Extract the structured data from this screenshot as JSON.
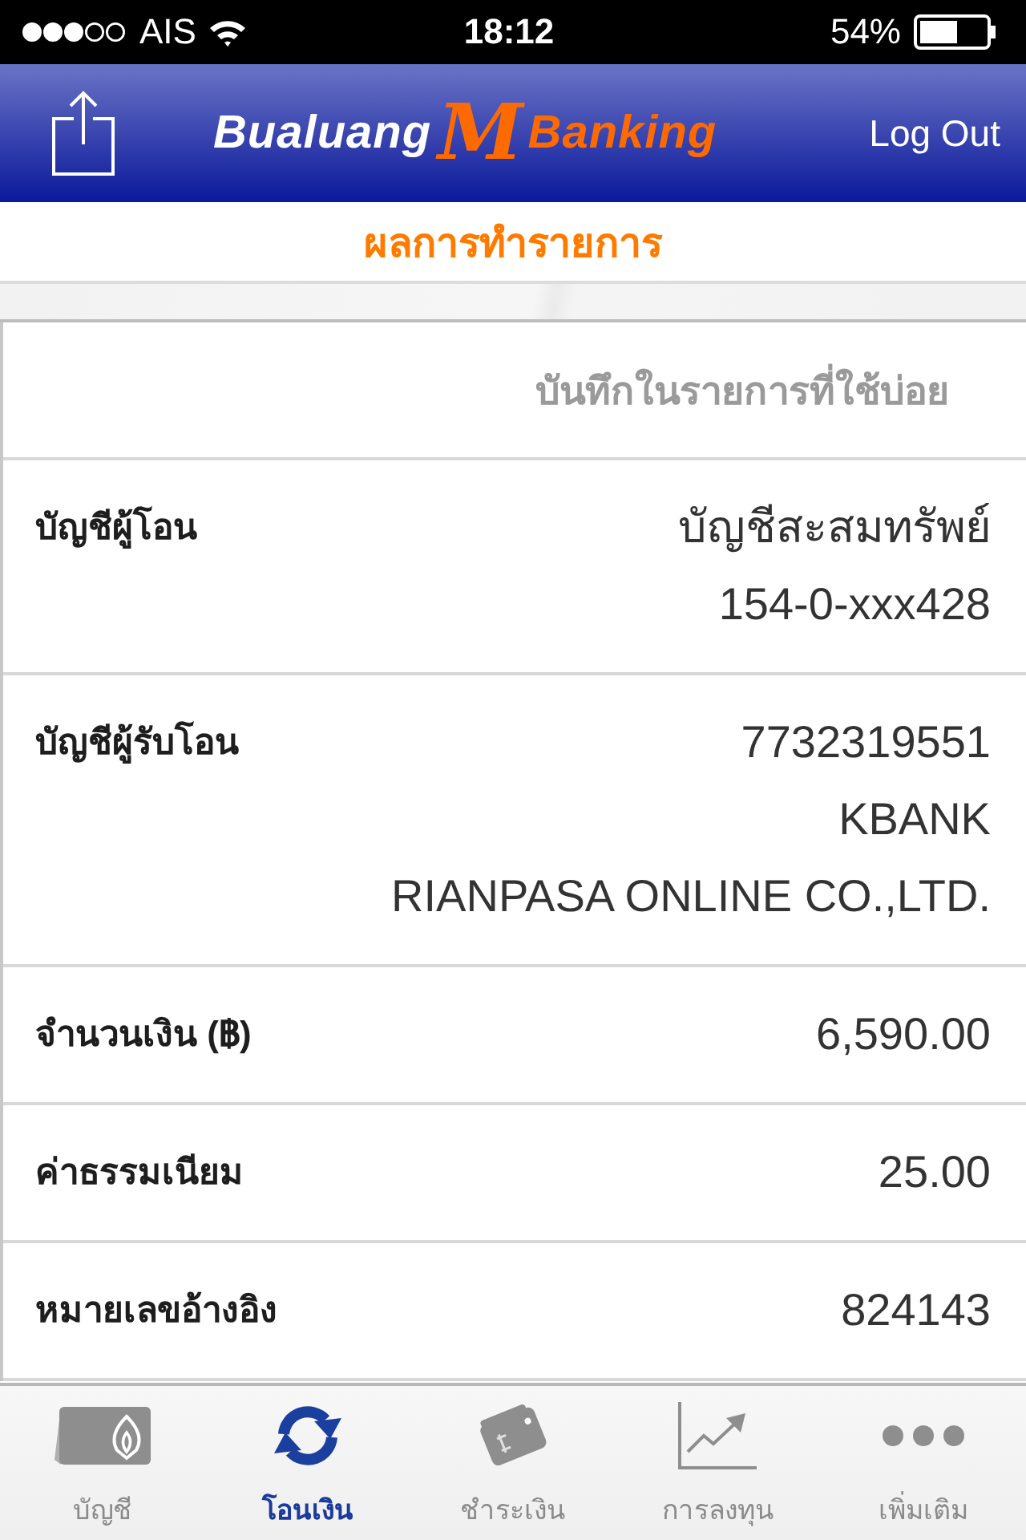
{
  "status_bar": {
    "carrier": "AIS",
    "time": "18:12",
    "battery": "54%"
  },
  "header": {
    "logo": {
      "left": "Bualuang",
      "mark": "M",
      "right": "Banking"
    },
    "logout": "Log Out"
  },
  "page_title": "ผลการทำรายการ",
  "save_favorite": "บันทึกในรายการที่ใช้บ่อย",
  "details": [
    {
      "label": "บัญชีผู้โอน",
      "values": [
        "บัญชีสะสมทรัพย์",
        "154-0-xxx428"
      ]
    },
    {
      "label": "บัญชีผู้รับโอน",
      "values": [
        "7732319551",
        "KBANK",
        "RIANPASA ONLINE CO.,LTD."
      ]
    },
    {
      "label": "จำนวนเงิน (฿)",
      "values": [
        "6,590.00"
      ]
    },
    {
      "label": "ค่าธรรมเนียม",
      "values": [
        "25.00"
      ]
    },
    {
      "label": "หมายเลขอ้างอิง",
      "values": [
        "824143"
      ]
    }
  ],
  "tabs": [
    {
      "label": "บัญชี",
      "kind": "accounts",
      "selected": false
    },
    {
      "label": "โอนเงิน",
      "kind": "transfer",
      "selected": true
    },
    {
      "label": "ชำระเงิน",
      "kind": "payment",
      "selected": false
    },
    {
      "label": "การลงทุน",
      "kind": "invest",
      "selected": false
    },
    {
      "label": "เพิ่มเติม",
      "kind": "more",
      "selected": false
    }
  ]
}
